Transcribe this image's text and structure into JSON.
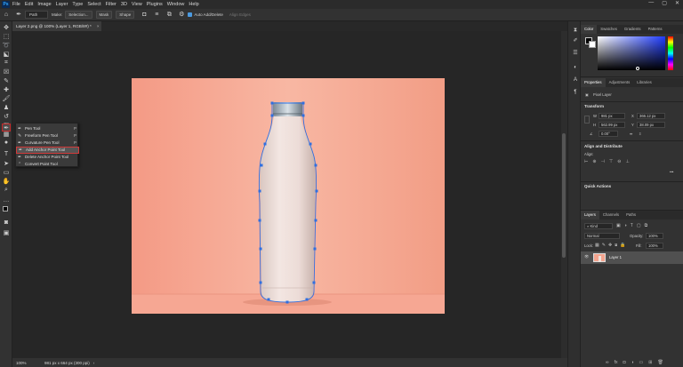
{
  "app": {
    "logo": "Ps"
  },
  "menu": [
    "File",
    "Edit",
    "Image",
    "Layer",
    "Type",
    "Select",
    "Filter",
    "3D",
    "View",
    "Plugins",
    "Window",
    "Help"
  ],
  "window_controls": [
    "—",
    "▢",
    "✕"
  ],
  "options_bar": {
    "mode_value": "Path",
    "make_label": "Make:",
    "selection_button": "Selection...",
    "mask_button": "Mask",
    "shape_button": "Shape",
    "auto_add_delete": "Auto Add/Delete",
    "align_edges": "Align Edges"
  },
  "document": {
    "tab_title": "Layer 2.png @ 100% (Layer 1, RGB/8#) *"
  },
  "pen_flyout": {
    "items": [
      {
        "label": "Pen Tool",
        "key": "P"
      },
      {
        "label": "Freeform Pen Tool",
        "key": "P"
      },
      {
        "label": "Curvature Pen Tool",
        "key": "P"
      },
      {
        "label": "Add Anchor Point Tool",
        "key": ""
      },
      {
        "label": "Delete Anchor Point Tool",
        "key": ""
      },
      {
        "label": "Convert Point Tool",
        "key": ""
      }
    ],
    "highlighted_index": 3
  },
  "status": {
    "zoom": "100%",
    "doc_size": "981 px x 664 px (300 ppi)"
  },
  "panels": {
    "top_tabs": [
      "Color",
      "Swatches",
      "Gradients",
      "Patterns"
    ],
    "prop_tabs": [
      "Properties",
      "Adjustments",
      "Libraries"
    ],
    "pixel_layer": "Pixel Layer",
    "transform": {
      "title": "Transform",
      "w_label": "W",
      "w": "981 px",
      "h_label": "H",
      "h": "562.99 px",
      "x_label": "X",
      "x": "366.12 px",
      "y_label": "Y",
      "y": "38.09 px",
      "angle": "0.00°"
    },
    "align": {
      "title": "Align and Distribute",
      "align_label": "Align:"
    },
    "quick_actions": "Quick Actions",
    "layers_tabs": [
      "Layers",
      "Channels",
      "Paths"
    ],
    "kind": "Kind",
    "blend": "Normal",
    "opacity_label": "Opacity:",
    "opacity": "100%",
    "lock_label": "Lock:",
    "fill_label": "Fill:",
    "fill": "100%",
    "layer_name": "Layer 1"
  },
  "colors": {
    "accent_red": "#d23a3a",
    "anchor_blue": "#2f6fe0",
    "background_peach": "#f4a48e",
    "bottle": "#eadbd6"
  }
}
